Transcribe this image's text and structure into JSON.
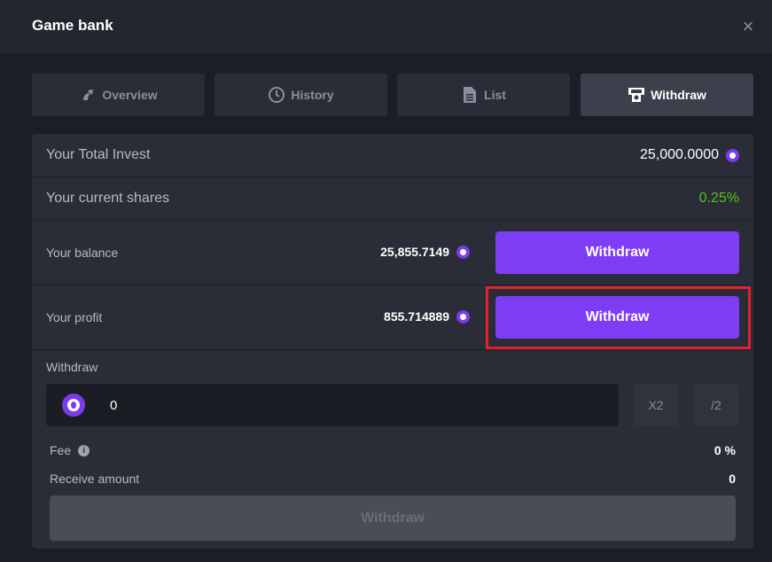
{
  "header": {
    "title": "Game bank",
    "close_icon": "×"
  },
  "tabs": [
    {
      "label": "Overview",
      "icon": "overview-icon",
      "active": false
    },
    {
      "label": "History",
      "icon": "clock-icon",
      "active": false
    },
    {
      "label": "List",
      "icon": "document-icon",
      "active": false
    },
    {
      "label": "Withdraw",
      "icon": "withdraw-icon",
      "active": true
    }
  ],
  "stats": {
    "total_invest_label": "Your Total Invest",
    "total_invest_value": "25,000.0000",
    "shares_label": "Your current shares",
    "shares_value": "0.25%",
    "balance_label": "Your balance",
    "balance_value": "25,855.7149",
    "profit_label": "Your profit",
    "profit_value": "855.714889",
    "withdraw_button": "Withdraw"
  },
  "form": {
    "withdraw_label": "Withdraw",
    "amount_value": "0",
    "x2_label": "X2",
    "half_label": "/2",
    "fee_label": "Fee",
    "fee_value": "0 %",
    "receive_label": "Receive amount",
    "receive_value": "0",
    "submit_label": "Withdraw"
  },
  "colors": {
    "accent": "#7f3cf5",
    "positive": "#53c41a",
    "highlight": "#e3202c"
  }
}
